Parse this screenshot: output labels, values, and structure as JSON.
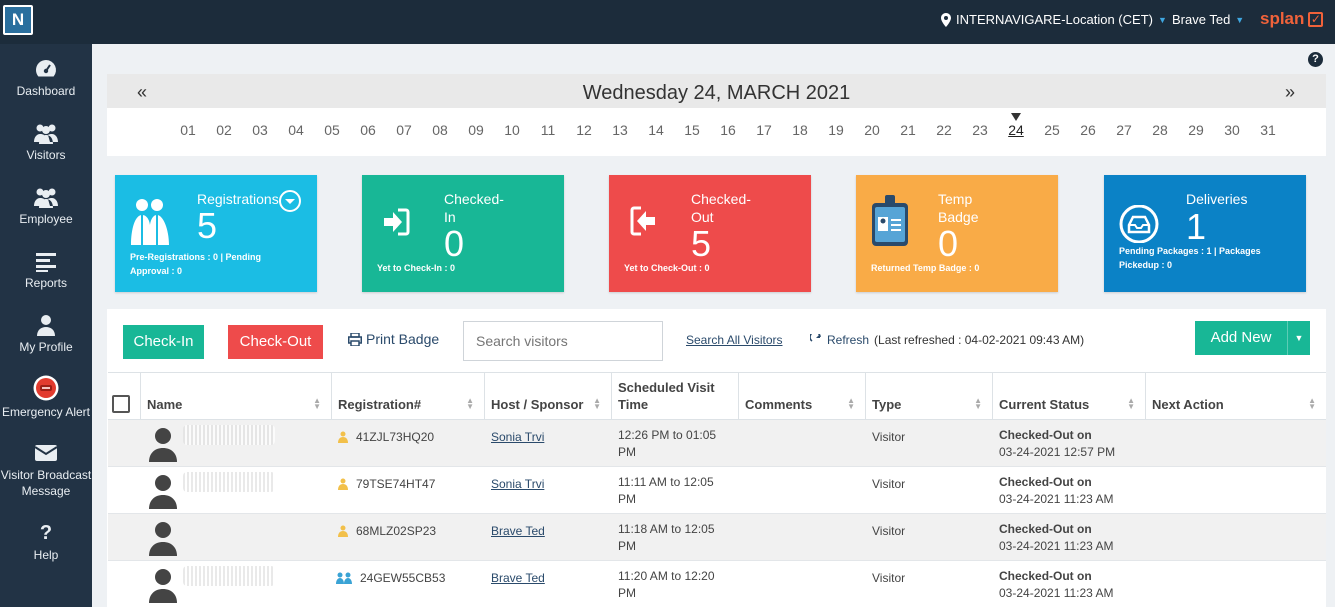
{
  "topbar": {
    "logo": "N",
    "location": "INTERNAVIGARE-Location (CET)",
    "user": "Brave Ted",
    "brand": "splan"
  },
  "sidebar": {
    "items": [
      {
        "label": "Dashboard",
        "icon": "dashboard-icon"
      },
      {
        "label": "Visitors",
        "icon": "visitors-icon"
      },
      {
        "label": "Employee",
        "icon": "employee-icon"
      },
      {
        "label": "Reports",
        "icon": "reports-icon"
      },
      {
        "label": "My Profile",
        "icon": "profile-icon"
      },
      {
        "label": "Emergency Alert",
        "icon": "alert-icon"
      },
      {
        "label": "Visitor Broadcast Message",
        "icon": "mail-icon"
      },
      {
        "label": "Help",
        "icon": "help-icon"
      }
    ]
  },
  "calendar": {
    "title": "Wednesday 24, MARCH 2021",
    "prev": "«",
    "next": "»",
    "days": [
      "01",
      "02",
      "03",
      "04",
      "05",
      "06",
      "07",
      "08",
      "09",
      "10",
      "11",
      "12",
      "13",
      "14",
      "15",
      "16",
      "17",
      "18",
      "19",
      "20",
      "21",
      "22",
      "23",
      "24",
      "25",
      "26",
      "27",
      "28",
      "29",
      "30",
      "31"
    ],
    "selected": "24"
  },
  "cards": {
    "registrations": {
      "title": "Registrations",
      "count": "5",
      "sub": "Pre-Registrations : 0 | Pending Approval : 0",
      "color": "#1bbde4"
    },
    "checked_in": {
      "title": "Checked-In",
      "count": "0",
      "sub": "Yet to Check-In : 0",
      "color": "#18b796"
    },
    "checked_out": {
      "title": "Checked-Out",
      "count": "5",
      "sub": "Yet to Check-Out : 0",
      "color": "#ee4b4b"
    },
    "temp_badge": {
      "title": "Temp Badge",
      "count": "0",
      "sub": "Returned Temp Badge : 0",
      "color": "#f9ab47"
    },
    "deliveries": {
      "title": "Deliveries",
      "count": "1",
      "sub": "Pending Packages : 1 | Packages Pickedup : 0",
      "color": "#0b82c6"
    }
  },
  "toolbar": {
    "checkin": "Check-In",
    "checkout": "Check-Out",
    "print_badge": "Print Badge",
    "search_placeholder": "Search visitors",
    "search_all": "Search All Visitors",
    "refresh": "Refresh",
    "last_refreshed": "(Last refreshed : 04-02-2021 09:43 AM)",
    "add_new": "Add New"
  },
  "table": {
    "columns": [
      "Name",
      "Registration#",
      "Host / Sponsor",
      "Scheduled Visit Time",
      "Comments",
      "Type",
      "Current Status",
      "Next Action"
    ],
    "rows": [
      {
        "reg": "41ZJL73HQ20",
        "host": "Sonia Trvi",
        "time": "12:26 PM to 01:05 PM",
        "comments": "",
        "type": "Visitor",
        "status": "Checked-Out on",
        "status_date": "03-24-2021 12:57 PM"
      },
      {
        "reg": "79TSE74HT47",
        "host": "Sonia Trvi",
        "time": "11:11 AM to 12:05 PM",
        "comments": "",
        "type": "Visitor",
        "status": "Checked-Out on",
        "status_date": "03-24-2021 11:23 AM"
      },
      {
        "reg": "68MLZ02SP23",
        "host": "Brave Ted",
        "time": "11:18 AM to 12:05 PM",
        "comments": "",
        "type": "Visitor",
        "status": "Checked-Out on",
        "status_date": "03-24-2021 11:23 AM"
      },
      {
        "reg": "24GEW55CB53",
        "host": "Brave Ted",
        "time": "11:20 AM to 12:20 PM",
        "comments": "",
        "type": "Visitor",
        "status": "Checked-Out on",
        "status_date": "03-24-2021 11:23 AM"
      }
    ]
  }
}
